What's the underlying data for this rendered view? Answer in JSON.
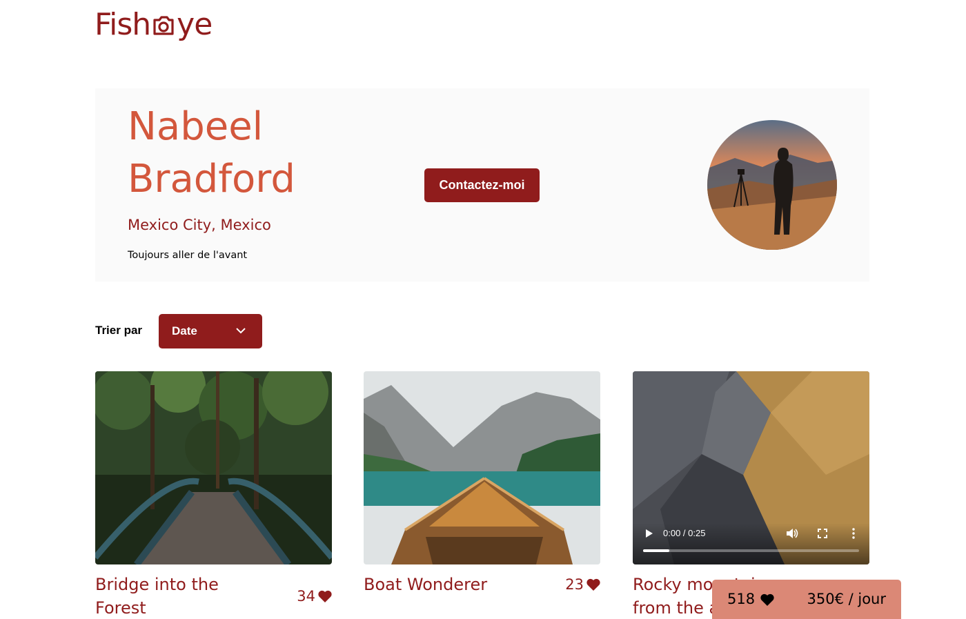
{
  "logo": {
    "text_left": "Fish",
    "text_right": "ye",
    "icon": "camera-icon"
  },
  "photographer": {
    "name_line1": "Nabeel",
    "name_line2": "Bradford",
    "location": "Mexico City, Mexico",
    "tagline": "Toujours aller de l'avant",
    "contact_label": "Contactez-moi"
  },
  "sort": {
    "label": "Trier par",
    "selected": "Date"
  },
  "media": [
    {
      "title": "Bridge into the Forest",
      "likes": "34",
      "type": "image"
    },
    {
      "title": "Boat Wonderer",
      "likes": "23",
      "type": "image"
    },
    {
      "title": "Rocky mountains from the air",
      "likes": "",
      "type": "video",
      "video_time": "0:00 / 0:25",
      "video_progress": 0.12
    }
  ],
  "summary": {
    "total_likes": "518",
    "price": "350€ / jour"
  },
  "colors": {
    "primary": "#901C1C",
    "secondary": "#D3573C",
    "tertiary": "#DB8876",
    "header_bg": "#FAFAFA"
  }
}
